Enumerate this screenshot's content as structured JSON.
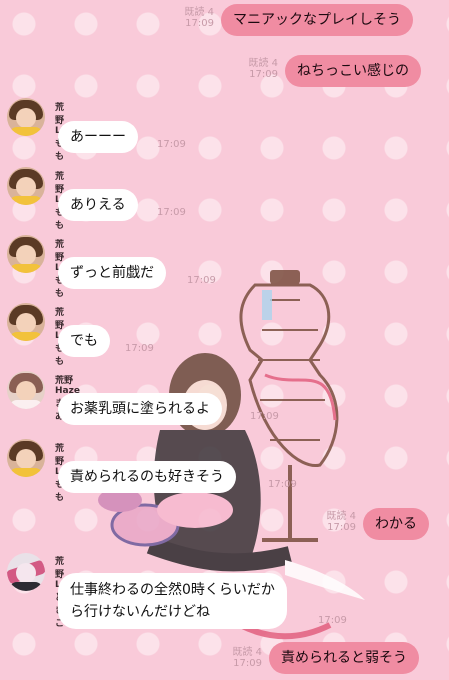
{
  "outgoing": [
    {
      "status": "既読 4",
      "time": "17:09",
      "text": "マニアックなプレイしそう"
    },
    {
      "status": "既読 4",
      "time": "17:09",
      "text": "ねちっこい感じの"
    },
    {
      "status": "既読 4",
      "time": "17:09",
      "text": "わかる"
    },
    {
      "status": "既読 4",
      "time": "17:09",
      "text": "責められると弱そう"
    }
  ],
  "incoming": [
    {
      "sender": "荒野 Lt もも",
      "text": "あーーー",
      "time": "17:09",
      "avatar_icon": "user-avatar-momo"
    },
    {
      "sender": "荒野 Lt もも",
      "text": "ありえる",
      "time": "17:09",
      "avatar_icon": "user-avatar-momo"
    },
    {
      "sender": "荒野 Lt もも",
      "text": "ずっと前戯だ",
      "time": "17:09",
      "avatar_icon": "user-avatar-momo"
    },
    {
      "sender": "荒野 Lt もも",
      "text": "でも",
      "time": "17:09",
      "avatar_icon": "user-avatar-momo"
    },
    {
      "sender": "荒野 Haze まりあ",
      "text": "お薬乳頭に塗られるよ",
      "time": "17:09",
      "avatar_icon": "user-avatar-maria"
    },
    {
      "sender": "荒野 Lt もも",
      "text": "責められるのも好きそう",
      "time": "17:09",
      "avatar_icon": "user-avatar-momo"
    },
    {
      "sender": "荒野 Lt どきこ",
      "line1": "仕事終わるの全然0時くらいだか",
      "line2": "ら行けないんだけどね",
      "time": "17:09",
      "avatar_icon": "user-avatar-dokiko"
    }
  ],
  "colors": {
    "background": "#f9cad9",
    "outgoing_bubble": "#f08ca2",
    "incoming_bubble": "#ffffff",
    "meta_text": "#c79aa8"
  }
}
